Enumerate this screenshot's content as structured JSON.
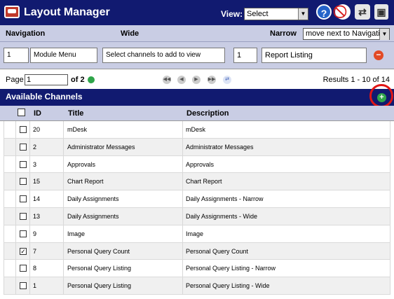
{
  "app": {
    "title": "Layout Manager"
  },
  "view": {
    "label": "View:",
    "selected": "Select"
  },
  "nav": {
    "navigation": "Navigation",
    "wide": "Wide",
    "narrow": "Narrow",
    "narrow_selected": "move next to Navigation"
  },
  "channel": {
    "index": "1",
    "name": "Module Menu",
    "prompt": "Select channels to add to view",
    "pos": "1",
    "listing": "Report Listing"
  },
  "pager": {
    "page_label": "Page",
    "page": "1",
    "of": "of 2",
    "results": "Results 1 - 10 of 14"
  },
  "available": {
    "title": "Available Channels"
  },
  "table": {
    "headers": {
      "id": "ID",
      "title": "Title",
      "description": "Description"
    },
    "rows": [
      {
        "id": "20",
        "title": "mDesk",
        "description": "mDesk",
        "checked": false
      },
      {
        "id": "2",
        "title": "Administrator Messages",
        "description": "Administrator Messages",
        "checked": false
      },
      {
        "id": "3",
        "title": "Approvals",
        "description": "Approvals",
        "checked": false
      },
      {
        "id": "15",
        "title": "Chart Report",
        "description": "Chart Report",
        "checked": false
      },
      {
        "id": "14",
        "title": "Daily Assignments",
        "description": "Daily Assignments - Narrow",
        "checked": false
      },
      {
        "id": "13",
        "title": "Daily Assignments",
        "description": "Daily Assignments - Wide",
        "checked": false
      },
      {
        "id": "9",
        "title": "Image",
        "description": "Image",
        "checked": false
      },
      {
        "id": "7",
        "title": "Personal Query Count",
        "description": "Personal Query Count",
        "checked": true
      },
      {
        "id": "8",
        "title": "Personal Query Listing",
        "description": "Personal Query Listing - Narrow",
        "checked": false
      },
      {
        "id": "1",
        "title": "Personal Query Listing",
        "description": "Personal Query Listing - Wide",
        "checked": false
      }
    ]
  },
  "colors": {
    "brand": "#111a70",
    "panel": "#c9cde4",
    "highlight": "#e01515",
    "add": "#2fa54a"
  }
}
